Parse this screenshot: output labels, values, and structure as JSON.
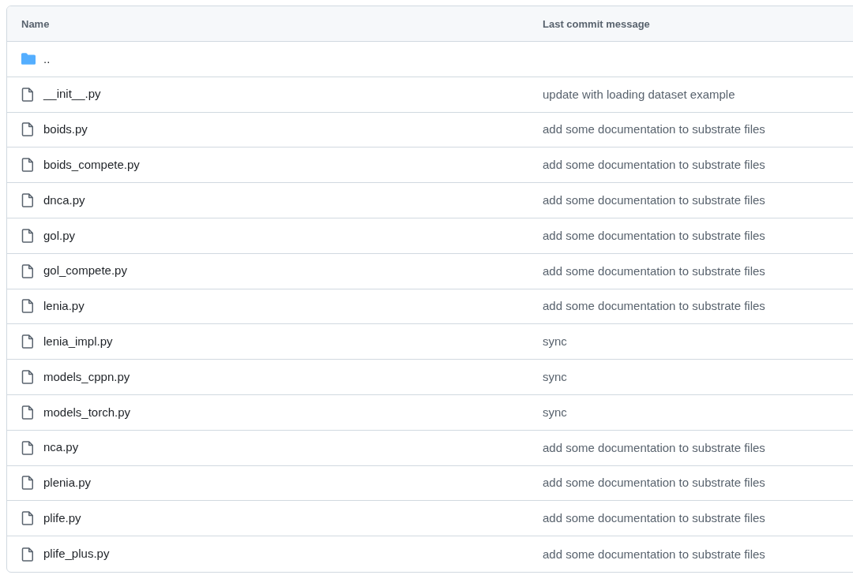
{
  "table": {
    "columns": [
      "Name",
      "Last commit message"
    ],
    "rows": [
      {
        "kind": "folder",
        "name": "..",
        "message": ""
      },
      {
        "kind": "file",
        "name": "__init__.py",
        "message": "update with loading dataset example"
      },
      {
        "kind": "file",
        "name": "boids.py",
        "message": "add some documentation to substrate files"
      },
      {
        "kind": "file",
        "name": "boids_compete.py",
        "message": "add some documentation to substrate files"
      },
      {
        "kind": "file",
        "name": "dnca.py",
        "message": "add some documentation to substrate files"
      },
      {
        "kind": "file",
        "name": "gol.py",
        "message": "add some documentation to substrate files"
      },
      {
        "kind": "file",
        "name": "gol_compete.py",
        "message": "add some documentation to substrate files"
      },
      {
        "kind": "file",
        "name": "lenia.py",
        "message": "add some documentation to substrate files"
      },
      {
        "kind": "file",
        "name": "lenia_impl.py",
        "message": "sync"
      },
      {
        "kind": "file",
        "name": "models_cppn.py",
        "message": "sync"
      },
      {
        "kind": "file",
        "name": "models_torch.py",
        "message": "sync"
      },
      {
        "kind": "file",
        "name": "nca.py",
        "message": "add some documentation to substrate files"
      },
      {
        "kind": "file",
        "name": "plenia.py",
        "message": "add some documentation to substrate files"
      },
      {
        "kind": "file",
        "name": "plife.py",
        "message": "add some documentation to substrate files"
      },
      {
        "kind": "file",
        "name": "plife_plus.py",
        "message": "add some documentation to substrate files"
      }
    ]
  }
}
